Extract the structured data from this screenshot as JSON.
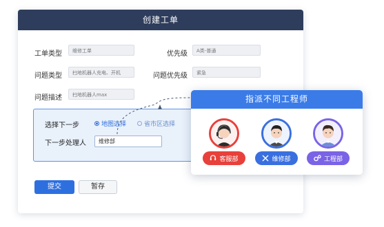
{
  "form": {
    "title": "创建工单",
    "fields": {
      "ticket_type": {
        "label": "工单类型",
        "value": "维修工单"
      },
      "priority": {
        "label": "优先级",
        "value": "A类-普通"
      },
      "issue_type": {
        "label": "问题类型",
        "value": "扫地机器人充电、开机"
      },
      "issue_priority": {
        "label": "问题优先级",
        "value": "紧急"
      },
      "issue_desc": {
        "label": "问题描述",
        "value": "扫地机器人max"
      }
    },
    "next_step": {
      "label": "选择下一步",
      "options": [
        "地图选择",
        "省市区选择"
      ],
      "selected": "地图选择",
      "handler_label": "下一步处理人",
      "handler_value": "维修部"
    },
    "buttons": {
      "submit": "提交",
      "save": "暂存"
    }
  },
  "dispatch": {
    "title": "指派不同工程师",
    "departments": [
      {
        "label": "客服部",
        "color": "#e8403a",
        "icon": "headset-icon"
      },
      {
        "label": "维修部",
        "color": "#3a6fe0",
        "icon": "tools-icon"
      },
      {
        "label": "工程部",
        "color": "#7a63e6",
        "icon": "gear-icon"
      }
    ]
  }
}
